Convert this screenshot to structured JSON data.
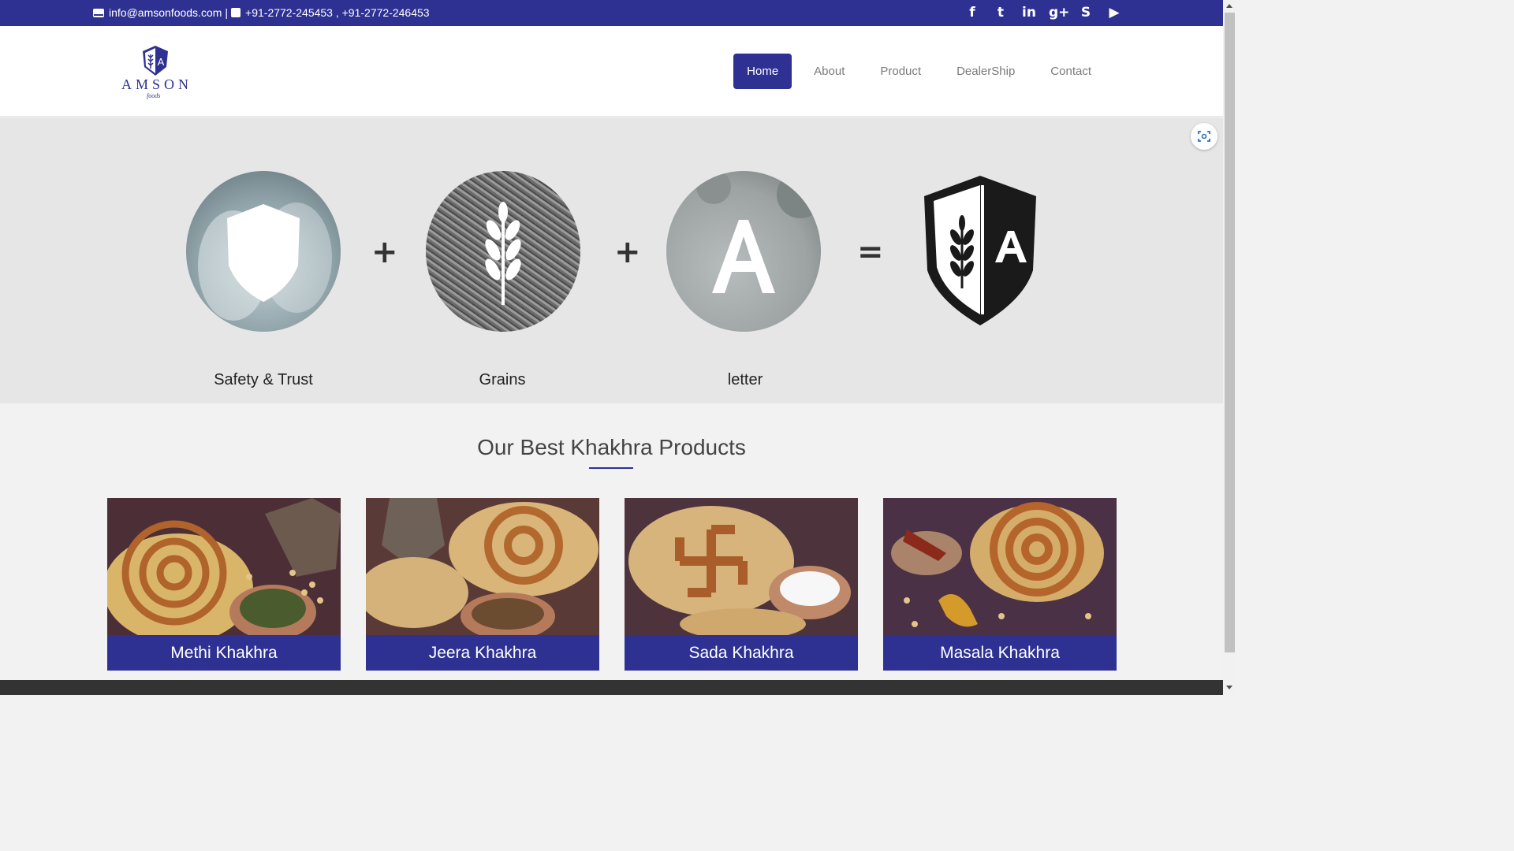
{
  "topbar": {
    "email": "info@amsonfoods.com",
    "separator": "|",
    "phones": "+91-2772-245453 , +91-2772-246453",
    "social": [
      {
        "icon": "facebook-icon",
        "glyph": "f"
      },
      {
        "icon": "twitter-icon",
        "glyph": "t"
      },
      {
        "icon": "linkedin-icon",
        "glyph": "in"
      },
      {
        "icon": "google-plus-icon",
        "glyph": "g+"
      },
      {
        "icon": "skype-icon",
        "glyph": "S"
      },
      {
        "icon": "youtube-icon",
        "glyph": "▶"
      }
    ]
  },
  "logo": {
    "brand": "AMSON",
    "sub": "foods"
  },
  "nav": {
    "items": [
      "Home",
      "About",
      "Product",
      "DealerShip",
      "Contact"
    ],
    "active": "Home"
  },
  "hero": {
    "captions": [
      "Safety & Trust",
      "Grains",
      "letter"
    ],
    "operators": [
      "+",
      "+",
      "="
    ]
  },
  "products": {
    "title": "Our Best Khakhra Products",
    "items": [
      {
        "name": "Methi Khakhra"
      },
      {
        "name": "Jeera Khakhra"
      },
      {
        "name": "Sada Khakhra"
      },
      {
        "name": "Masala Khakhra"
      }
    ]
  },
  "colors": {
    "brand": "#2e3192",
    "hero_bg": "#e6e6e6",
    "page_bg": "#f2f2f2"
  }
}
